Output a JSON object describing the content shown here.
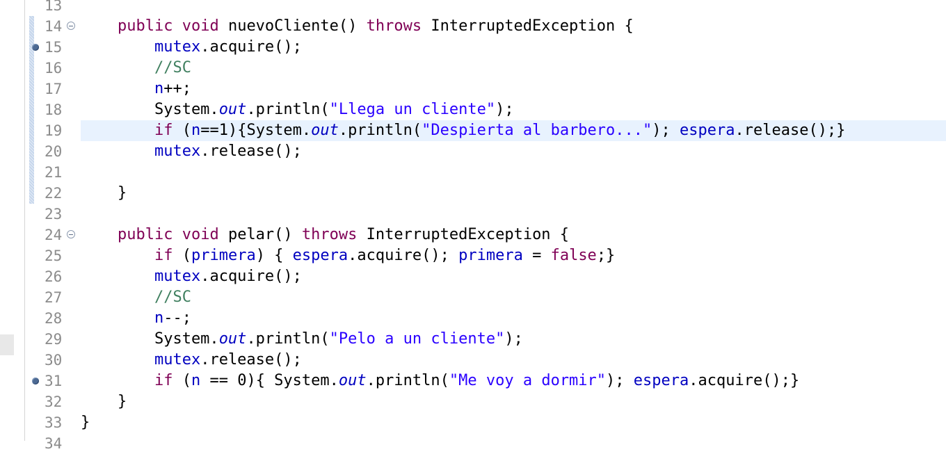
{
  "editor": {
    "lines": [
      {
        "number": "13",
        "tokens": []
      },
      {
        "number": "14",
        "fold": true,
        "tokens": [
          {
            "t": "    "
          },
          {
            "t": "public",
            "c": "kw"
          },
          {
            "t": " "
          },
          {
            "t": "void",
            "c": "kw"
          },
          {
            "t": " nuevoCliente() "
          },
          {
            "t": "throws",
            "c": "kw"
          },
          {
            "t": " InterruptedException {"
          }
        ]
      },
      {
        "number": "15",
        "breakpoint": true,
        "tokens": [
          {
            "t": "        "
          },
          {
            "t": "mutex",
            "c": "fld"
          },
          {
            "t": ".acquire();"
          }
        ]
      },
      {
        "number": "16",
        "tokens": [
          {
            "t": "        "
          },
          {
            "t": "//SC",
            "c": "cmt"
          }
        ]
      },
      {
        "number": "17",
        "tokens": [
          {
            "t": "        "
          },
          {
            "t": "n",
            "c": "fld"
          },
          {
            "t": "++;"
          }
        ]
      },
      {
        "number": "18",
        "tokens": [
          {
            "t": "        System."
          },
          {
            "t": "out",
            "c": "sfld"
          },
          {
            "t": ".println("
          },
          {
            "t": "\"Llega un cliente\"",
            "c": "str"
          },
          {
            "t": ");"
          }
        ]
      },
      {
        "number": "19",
        "current": true,
        "tokens": [
          {
            "t": "        "
          },
          {
            "t": "if",
            "c": "kw"
          },
          {
            "t": " ("
          },
          {
            "t": "n",
            "c": "fld"
          },
          {
            "t": "==1){System."
          },
          {
            "t": "out",
            "c": "sfld"
          },
          {
            "t": ".println("
          },
          {
            "t": "\"Despierta al barbero...\"",
            "c": "str"
          },
          {
            "t": "); "
          },
          {
            "t": "espera",
            "c": "fld"
          },
          {
            "t": ".release();}"
          }
        ]
      },
      {
        "number": "20",
        "tokens": [
          {
            "t": "        "
          },
          {
            "t": "mutex",
            "c": "fld"
          },
          {
            "t": ".release();"
          }
        ]
      },
      {
        "number": "21",
        "tokens": []
      },
      {
        "number": "22",
        "tokens": [
          {
            "t": "    }"
          }
        ]
      },
      {
        "number": "23",
        "tokens": []
      },
      {
        "number": "24",
        "fold": true,
        "tokens": [
          {
            "t": "    "
          },
          {
            "t": "public",
            "c": "kw"
          },
          {
            "t": " "
          },
          {
            "t": "void",
            "c": "kw"
          },
          {
            "t": " pelar() "
          },
          {
            "t": "throws",
            "c": "kw"
          },
          {
            "t": " InterruptedException {"
          }
        ]
      },
      {
        "number": "25",
        "tokens": [
          {
            "t": "        "
          },
          {
            "t": "if",
            "c": "kw"
          },
          {
            "t": " ("
          },
          {
            "t": "primera",
            "c": "fld"
          },
          {
            "t": ") { "
          },
          {
            "t": "espera",
            "c": "fld"
          },
          {
            "t": ".acquire(); "
          },
          {
            "t": "primera",
            "c": "fld"
          },
          {
            "t": " = "
          },
          {
            "t": "false",
            "c": "kw"
          },
          {
            "t": ";}"
          }
        ]
      },
      {
        "number": "26",
        "tokens": [
          {
            "t": "        "
          },
          {
            "t": "mutex",
            "c": "fld"
          },
          {
            "t": ".acquire();"
          }
        ]
      },
      {
        "number": "27",
        "tokens": [
          {
            "t": "        "
          },
          {
            "t": "//SC",
            "c": "cmt"
          }
        ]
      },
      {
        "number": "28",
        "tokens": [
          {
            "t": "        "
          },
          {
            "t": "n",
            "c": "fld"
          },
          {
            "t": "--;"
          }
        ]
      },
      {
        "number": "29",
        "tokens": [
          {
            "t": "        System."
          },
          {
            "t": "out",
            "c": "sfld"
          },
          {
            "t": ".println("
          },
          {
            "t": "\"Pelo a un cliente\"",
            "c": "str"
          },
          {
            "t": ");"
          }
        ]
      },
      {
        "number": "30",
        "tokens": [
          {
            "t": "        "
          },
          {
            "t": "mutex",
            "c": "fld"
          },
          {
            "t": ".release();"
          }
        ]
      },
      {
        "number": "31",
        "breakpoint": true,
        "tokens": [
          {
            "t": "        "
          },
          {
            "t": "if",
            "c": "kw"
          },
          {
            "t": " ("
          },
          {
            "t": "n",
            "c": "fld"
          },
          {
            "t": " == 0){ System."
          },
          {
            "t": "out",
            "c": "sfld"
          },
          {
            "t": ".println("
          },
          {
            "t": "\"Me voy a dormir\"",
            "c": "str"
          },
          {
            "t": "); "
          },
          {
            "t": "espera",
            "c": "fld"
          },
          {
            "t": ".acquire();}"
          }
        ]
      },
      {
        "number": "32",
        "tokens": [
          {
            "t": "    }"
          }
        ]
      },
      {
        "number": "33",
        "tokens": [
          {
            "t": "}"
          }
        ]
      },
      {
        "number": "34",
        "tokens": []
      }
    ]
  },
  "colors": {
    "keyword": "#7f0055",
    "field": "#0000c0",
    "string": "#2a00ff",
    "comment": "#3f7f5f",
    "line_number": "#8b8b8b",
    "current_line": "#e8f2fe",
    "breakpoint": "#4d6a93"
  },
  "icons": {
    "fold": "collapse-minus-icon",
    "breakpoint": "breakpoint-dot-icon"
  }
}
